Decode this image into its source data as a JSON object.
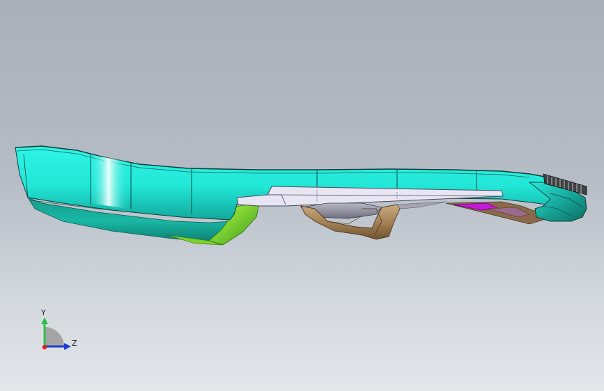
{
  "viewport": {
    "background_top": "#a9b0ba",
    "background_bottom": "#e3e6e9"
  },
  "model": {
    "colors": {
      "shell": "#27f0e1",
      "shell_dark": "#0f8f80",
      "shell_shadow": "#0c6c60",
      "highlight": "#eaffff",
      "plate": "#e6e2f2",
      "plate_edge": "#6a6680",
      "green_part": "#8ee02a",
      "bronze_part": "#b89668",
      "grey_part": "#8f8e9c",
      "magenta_part": "#c21ad6",
      "edges": "#1d2a2a"
    }
  },
  "triad": {
    "y_label": "Y",
    "z_label": "Z",
    "y_color": "#2cc24a",
    "z_color": "#1b3fd6",
    "x_color": "#e0201c"
  }
}
